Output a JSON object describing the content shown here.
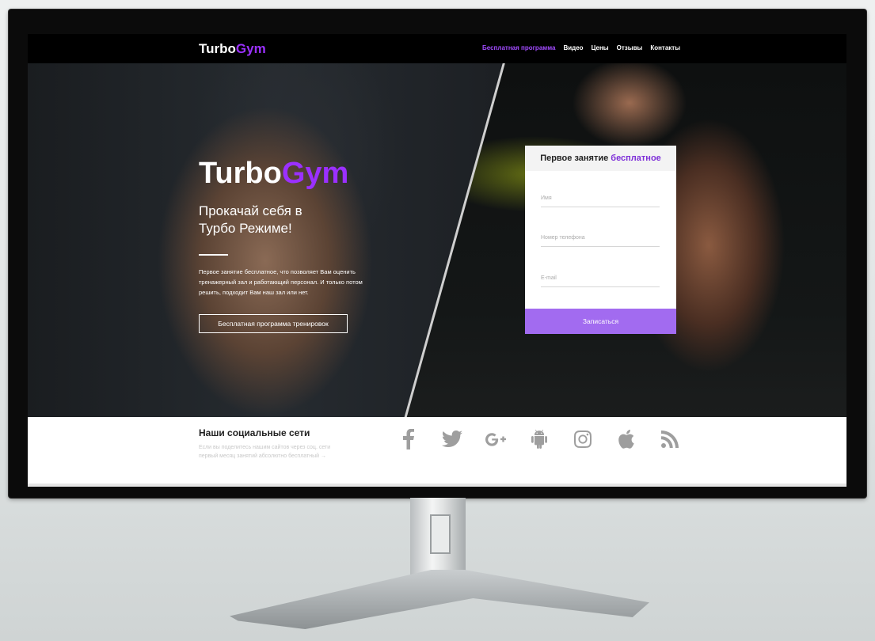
{
  "nav": {
    "logo_part1": "Turbo",
    "logo_part2": "Gym",
    "links": [
      "Бесплатная программа",
      "Видео",
      "Цены",
      "Отзывы",
      "Контакты"
    ]
  },
  "hero": {
    "title_part1": "Turbo",
    "title_part2": "Gym",
    "subtitle": "Прокачай себя в Турбо Режиме!",
    "text": "Первое занятие бесплатное, что позволяет Вам оценить тренажерный зал и работающий персонал. И только потом решить, подходит Вам наш зал или нет.",
    "button_label": "Бесплатная программа тренировок"
  },
  "form": {
    "header_part1": "Первое занятие ",
    "header_part2": "бесплатное",
    "fields": [
      "Имя",
      "Номер телефона",
      "E-mail"
    ],
    "submit_label": "Записаться"
  },
  "social": {
    "title": "Наши социальные сети",
    "text": "Если вы поделитесь нашим сайтов через соц. сети первый месяц занятий абсолютно бесплатный →",
    "icons": [
      "facebook-icon",
      "twitter-icon",
      "google-plus-icon",
      "android-icon",
      "instagram-icon",
      "apple-icon",
      "rss-icon"
    ]
  },
  "colors": {
    "accent": "#9b30ff",
    "submit": "#a26bf0",
    "icon_gray": "#9e9e9e"
  }
}
